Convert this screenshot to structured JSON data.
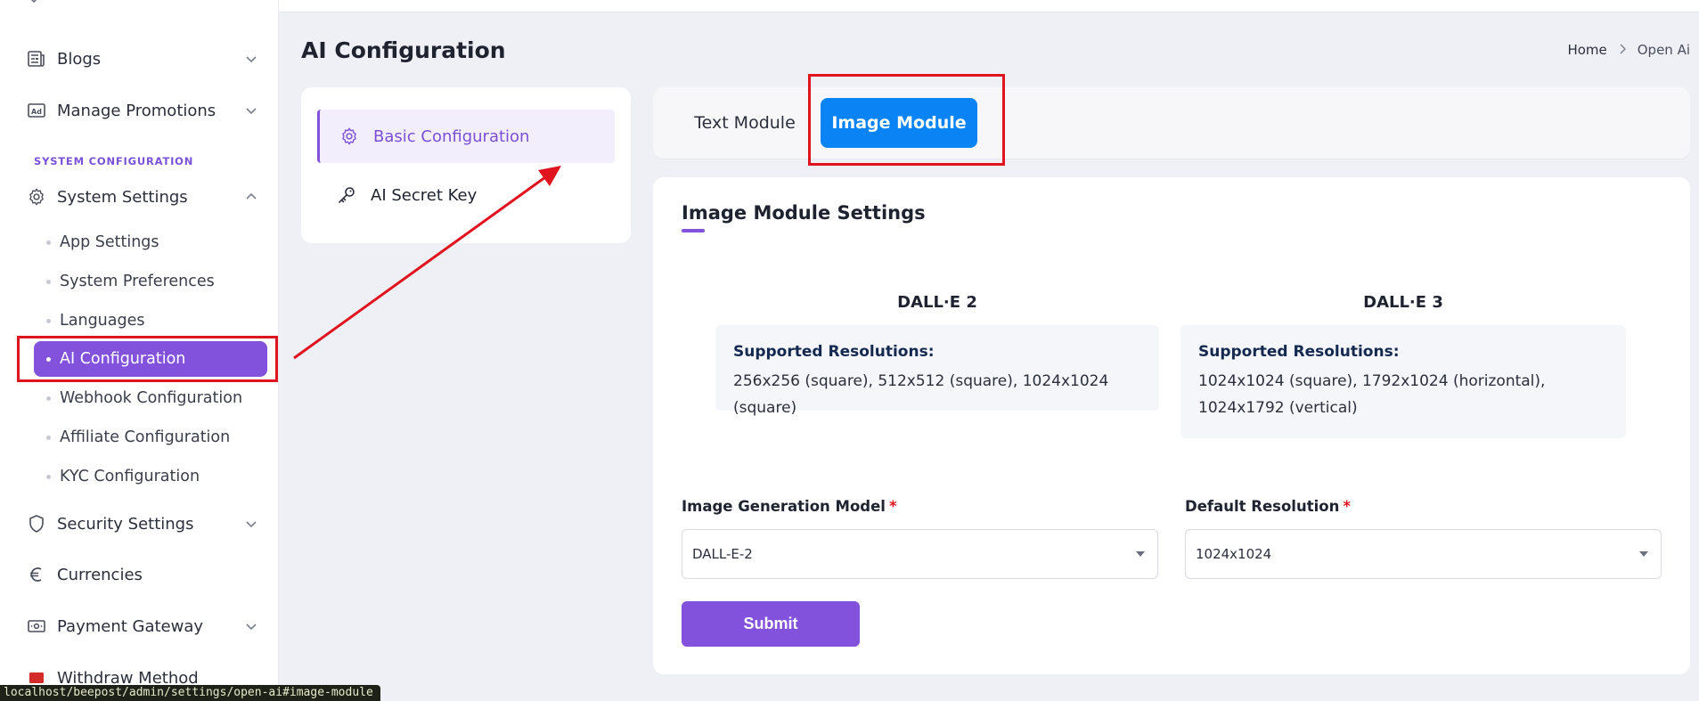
{
  "sidebar": {
    "items": [
      {
        "label": "Blogs",
        "icon": "blog-icon"
      },
      {
        "label": "Manage Promotions",
        "icon": "ad-icon"
      },
      {
        "label": "System Settings",
        "icon": "gear-icon"
      },
      {
        "label": "Security Settings",
        "icon": "shield-icon"
      },
      {
        "label": "Currencies",
        "icon": "euro-icon"
      },
      {
        "label": "Payment Gateway",
        "icon": "payment-icon"
      },
      {
        "label": "Withdraw Method",
        "icon": "withdraw-icon"
      }
    ],
    "section_label": "SYSTEM CONFIGURATION",
    "sub_items": [
      {
        "label": "App Settings"
      },
      {
        "label": "System Preferences"
      },
      {
        "label": "Languages"
      },
      {
        "label": "AI Configuration"
      },
      {
        "label": "Webhook Configuration"
      },
      {
        "label": "Affiliate Configuration"
      },
      {
        "label": "KYC Configuration"
      }
    ]
  },
  "header": {
    "title": "AI Configuration",
    "breadcrumb": {
      "home": "Home",
      "current": "Open Ai"
    }
  },
  "config_menu": {
    "items": [
      {
        "label": "Basic Configuration",
        "active": true
      },
      {
        "label": "AI Secret Key",
        "active": false
      }
    ]
  },
  "tabs": {
    "text": "Text Module",
    "image": "Image Module",
    "active": "Image Module"
  },
  "settings": {
    "title": "Image Module Settings",
    "models": [
      {
        "name": "DALL·E 2",
        "supported_label": "Supported Resolutions:",
        "resolutions": "256x256 (square), 512x512 (square), 1024x1024 (square)"
      },
      {
        "name": "DALL·E 3",
        "supported_label": "Supported Resolutions:",
        "resolutions": "1024x1024 (square), 1792x1024 (horizontal), 1024x1792 (vertical)"
      }
    ],
    "model_field": {
      "label": "Image Generation Model",
      "required_mark": "*",
      "value": "DALL-E-2"
    },
    "resolution_field": {
      "label": "Default Resolution",
      "required_mark": "*",
      "value": "1024x1024"
    },
    "submit": "Submit"
  },
  "status_url": "localhost/beepost/admin/settings/open-ai#image-module",
  "colors": {
    "accent": "#8352dd",
    "tab_active": "#0a84f5",
    "annotation": "#e0141e"
  }
}
